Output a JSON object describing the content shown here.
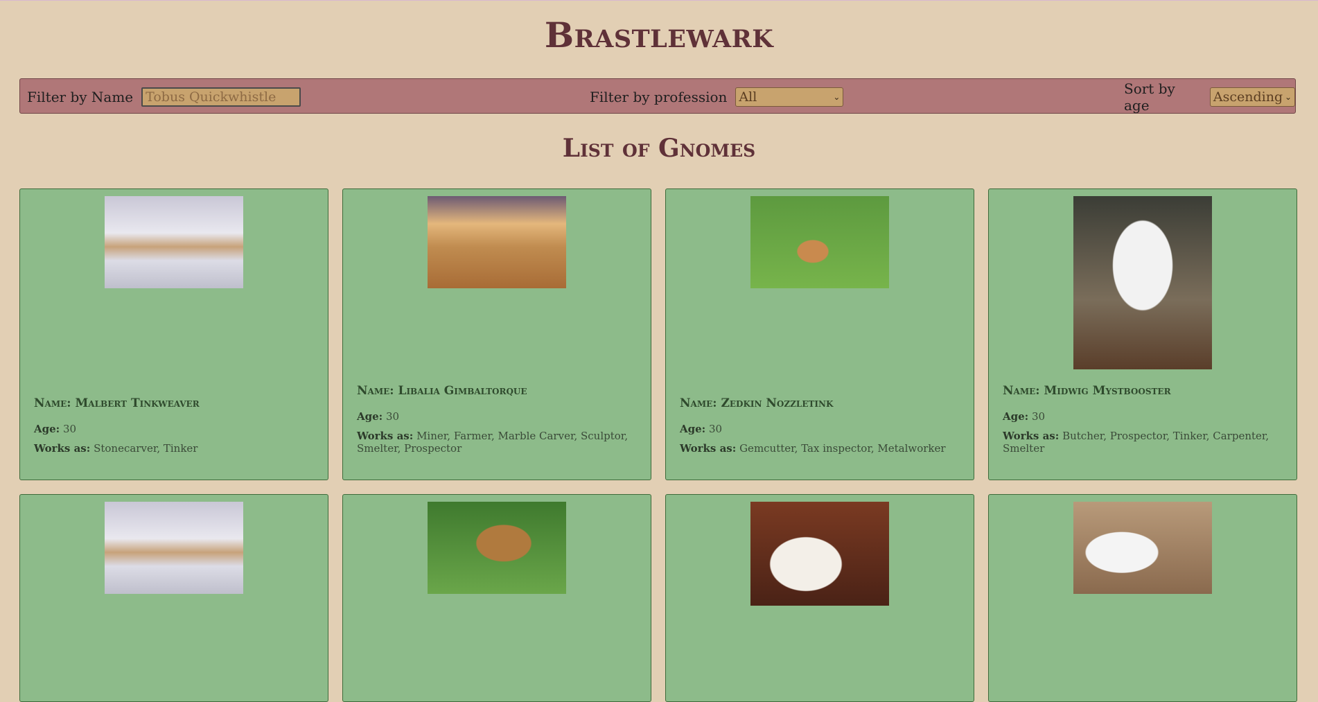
{
  "app": {
    "title": "Brastlewark"
  },
  "filters": {
    "name_label": "Filter by Name",
    "name_placeholder": "Tobus Quickwhistle",
    "profession_label": "Filter by profession",
    "profession_selected": "All",
    "sort_label": "Sort by age",
    "sort_selected": "Ascending"
  },
  "section": {
    "title": "List of Gnomes"
  },
  "labels": {
    "name": "Name:",
    "age": "Age:",
    "works": "Works as:"
  },
  "gnomes": [
    {
      "name": "Malbert Tinkweaver",
      "age": "30",
      "works": "Stonecarver, Tinker",
      "image": "snowy-creek-photo"
    },
    {
      "name": "Libalia Gimbaltorque",
      "age": "30",
      "works": "Miner, Farmer, Marble Carver, Sculptor, Smelter, Prospector",
      "image": "hay-bales-photo"
    },
    {
      "name": "Zedkin Nozzletink",
      "age": "30",
      "works": "Gemcutter, Tax inspector, Metalworker",
      "image": "fawn-photo"
    },
    {
      "name": "Midwig Mystbooster",
      "age": "30",
      "works": "Butcher, Prospector, Tinker, Carpenter, Smelter",
      "image": "snowy-owl-photo"
    },
    {
      "image": "snowy-creek-photo"
    },
    {
      "image": "giraffe-photo"
    },
    {
      "image": "white-lion-cub-photo"
    },
    {
      "image": "hen-photo"
    }
  ]
}
